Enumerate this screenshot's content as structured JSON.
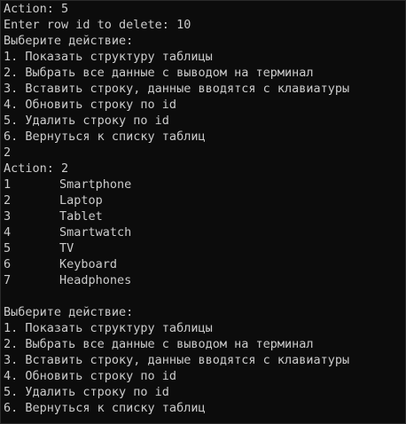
{
  "terminal": {
    "colors": {
      "background": "#0c0c0c",
      "text": "#cccccc"
    },
    "block1": [
      "Action: 5",
      "Enter row id to delete: 10"
    ],
    "menu1": {
      "prompt": "Выберите действие:",
      "items": [
        "1. Показать структуру таблицы",
        "2. Выбрать все данные с выводом на терминал",
        "3. Вставить строку, данные вводятся с клавиатуры",
        "4. Обновить строку по id",
        "5. Удалить строку по id",
        "6. Вернуться к списку таблиц"
      ]
    },
    "user_input": "2",
    "action_line": "Action: 2",
    "rows": [
      {
        "id": "1",
        "name": "Smartphone"
      },
      {
        "id": "2",
        "name": "Laptop"
      },
      {
        "id": "3",
        "name": "Tablet"
      },
      {
        "id": "4",
        "name": "Smartwatch"
      },
      {
        "id": "5",
        "name": "TV"
      },
      {
        "id": "6",
        "name": "Keyboard"
      },
      {
        "id": "7",
        "name": "Headphones"
      }
    ],
    "menu2": {
      "prompt": "Выберите действие:",
      "items": [
        "1. Показать структуру таблицы",
        "2. Выбрать все данные с выводом на терминал",
        "3. Вставить строку, данные вводятся с клавиатуры",
        "4. Обновить строку по id",
        "5. Удалить строку по id",
        "6. Вернуться к списку таблиц"
      ]
    }
  }
}
